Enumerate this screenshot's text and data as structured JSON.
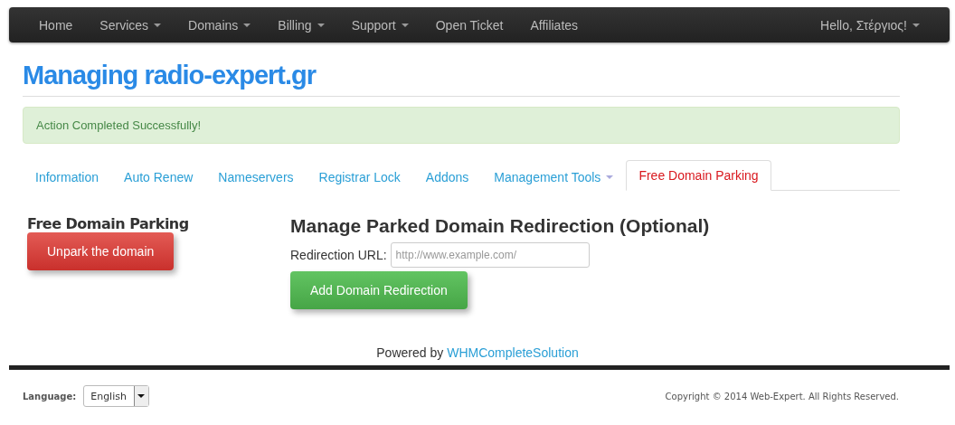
{
  "navbar": {
    "items": [
      {
        "label": "Home",
        "dropdown": false
      },
      {
        "label": "Services",
        "dropdown": true
      },
      {
        "label": "Domains",
        "dropdown": true
      },
      {
        "label": "Billing",
        "dropdown": true
      },
      {
        "label": "Support",
        "dropdown": true
      },
      {
        "label": "Open Ticket",
        "dropdown": false
      },
      {
        "label": "Affiliates",
        "dropdown": false
      }
    ],
    "user": {
      "label": "Hello, Στέργιος!",
      "dropdown": true
    }
  },
  "page_title": "Managing radio-expert.gr",
  "alert": "Action Completed Successfully!",
  "tabs": [
    {
      "label": "Information",
      "selected": false,
      "dropdown": false
    },
    {
      "label": "Auto Renew",
      "selected": false,
      "dropdown": false
    },
    {
      "label": "Nameservers",
      "selected": false,
      "dropdown": false
    },
    {
      "label": "Registrar Lock",
      "selected": false,
      "dropdown": false
    },
    {
      "label": "Addons",
      "selected": false,
      "dropdown": false
    },
    {
      "label": "Management Tools",
      "selected": false,
      "dropdown": true
    },
    {
      "label": "Free Domain Parking",
      "selected": true,
      "dropdown": false
    }
  ],
  "sidebar": {
    "heading": "Free Domain Parking",
    "button": "Unpark the domain"
  },
  "main": {
    "heading": "Manage Parked Domain Redirection (Optional)",
    "field_label": "Redirection URL:",
    "field_placeholder": "http://www.example.com/",
    "button": "Add Domain Redirection"
  },
  "powered_by": {
    "text": "Powered by",
    "link": "WHMCompleteSolution"
  },
  "footer": {
    "language_label": "Language:",
    "language_value": "English",
    "copyright": "Copyright © 2014 Web-Expert. All Rights Reserved."
  }
}
